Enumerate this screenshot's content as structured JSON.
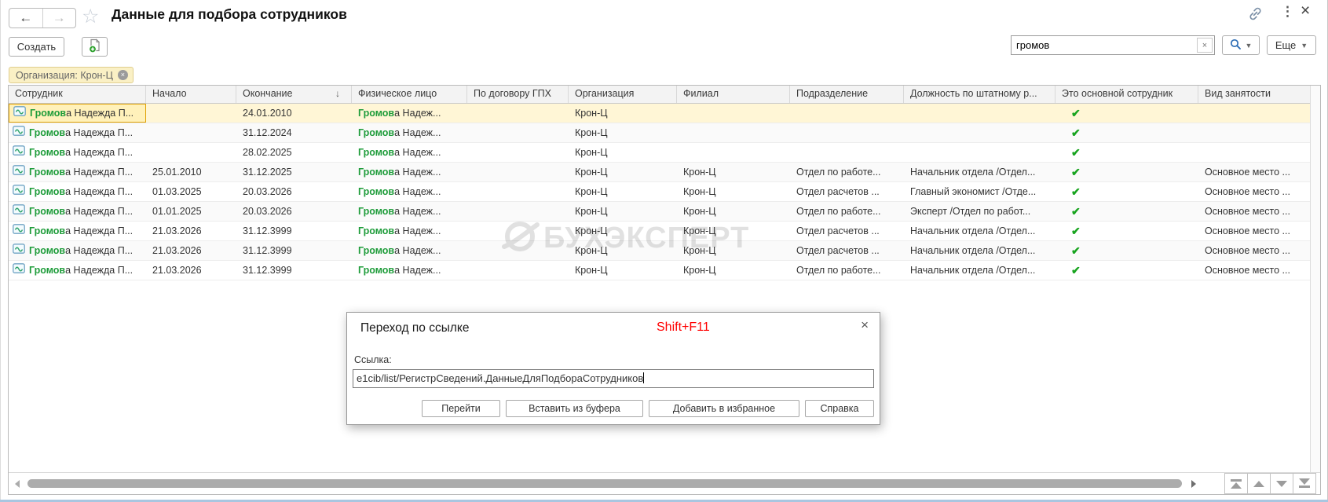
{
  "window": {
    "title": "Данные для подбора сотрудников",
    "back_glyph": "←",
    "forward_glyph": "→",
    "favorite_glyph": "☆",
    "menu_glyph": "⋮",
    "close_glyph": "×"
  },
  "toolbar": {
    "create_label": "Создать",
    "search": {
      "value": "громов",
      "clear_glyph": "×"
    },
    "more_label": "Еще",
    "dropdown_glyph": "▼"
  },
  "filter_chip": {
    "label": "Организация: Крон-Ц",
    "remove_glyph": "×"
  },
  "table": {
    "columns": [
      "Сотрудник",
      "Начало",
      "Окончание",
      "Физическое лицо",
      "По договору ГПХ",
      "Организация",
      "Филиал",
      "Подразделение",
      "Должность по штатному р...",
      "Это основной сотрудник",
      "Вид занятости"
    ],
    "sort_column": "Окончание",
    "sort_glyph": "↓",
    "highlight": "Громов",
    "check_glyph": "✔",
    "rows": [
      {
        "employee": "Громова Надежда П...",
        "start": "",
        "end": "24.01.2010",
        "person": "Громова Надеж...",
        "gph": "",
        "org": "Крон-Ц",
        "branch": "",
        "dept": "",
        "position": "",
        "is_main": true,
        "type": "",
        "selected": true
      },
      {
        "employee": "Громова Надежда П...",
        "start": "",
        "end": "31.12.2024",
        "person": "Громова Надеж...",
        "gph": "",
        "org": "Крон-Ц",
        "branch": "",
        "dept": "",
        "position": "",
        "is_main": true,
        "type": ""
      },
      {
        "employee": "Громова Надежда П...",
        "start": "",
        "end": "28.02.2025",
        "person": "Громова Надеж...",
        "gph": "",
        "org": "Крон-Ц",
        "branch": "",
        "dept": "",
        "position": "",
        "is_main": true,
        "type": ""
      },
      {
        "employee": "Громова Надежда П...",
        "start": "25.01.2010",
        "end": "31.12.2025",
        "person": "Громова Надеж...",
        "gph": "",
        "org": "Крон-Ц",
        "branch": "Крон-Ц",
        "dept": "Отдел по работе...",
        "position": "Начальник отдела /Отдел...",
        "is_main": true,
        "type": "Основное место ..."
      },
      {
        "employee": "Громова Надежда П...",
        "start": "01.03.2025",
        "end": "20.03.2026",
        "person": "Громова Надеж...",
        "gph": "",
        "org": "Крон-Ц",
        "branch": "Крон-Ц",
        "dept": "Отдел расчетов ...",
        "position": "Главный экономист /Отде...",
        "is_main": true,
        "type": "Основное место ..."
      },
      {
        "employee": "Громова Надежда П...",
        "start": "01.01.2025",
        "end": "20.03.2026",
        "person": "Громова Надеж...",
        "gph": "",
        "org": "Крон-Ц",
        "branch": "Крон-Ц",
        "dept": "Отдел по работе...",
        "position": "Эксперт /Отдел по работ...",
        "is_main": true,
        "type": "Основное место ..."
      },
      {
        "employee": "Громова Надежда П...",
        "start": "21.03.2026",
        "end": "31.12.3999",
        "person": "Громова Надеж...",
        "gph": "",
        "org": "Крон-Ц",
        "branch": "Крон-Ц",
        "dept": "Отдел расчетов ...",
        "position": "Начальник отдела /Отдел...",
        "is_main": true,
        "type": "Основное место ..."
      },
      {
        "employee": "Громова Надежда П...",
        "start": "21.03.2026",
        "end": "31.12.3999",
        "person": "Громова Надеж...",
        "gph": "",
        "org": "Крон-Ц",
        "branch": "Крон-Ц",
        "dept": "Отдел расчетов ...",
        "position": "Начальник отдела /Отдел...",
        "is_main": true,
        "type": "Основное место ..."
      },
      {
        "employee": "Громова Надежда П...",
        "start": "21.03.2026",
        "end": "31.12.3999",
        "person": "Громова Надеж...",
        "gph": "",
        "org": "Крон-Ц",
        "branch": "Крон-Ц",
        "dept": "Отдел по работе...",
        "position": "Начальник отдела /Отдел...",
        "is_main": true,
        "type": "Основное место ..."
      }
    ]
  },
  "watermark": {
    "text": "БУХЭКСПЕРТ"
  },
  "dialog": {
    "title": "Переход по ссылке",
    "hotkey": "Shift+F11",
    "link_label": "Ссылка:",
    "link_value": "e1cib/list/РегистрСведений.ДанныеДляПодбораСотрудников",
    "buttons": [
      "Перейти",
      "Вставить из буфера",
      "Добавить в избранное",
      "Справка"
    ],
    "close_glyph": "×"
  },
  "colors": {
    "match_green": "#1E9C3A",
    "check_green": "#18A41F",
    "selection_bg": "#FFF6D6",
    "active_cell_border": "#DFA000",
    "chip_bg": "#FAF0C5",
    "hotkey_red": "#FF0000"
  }
}
